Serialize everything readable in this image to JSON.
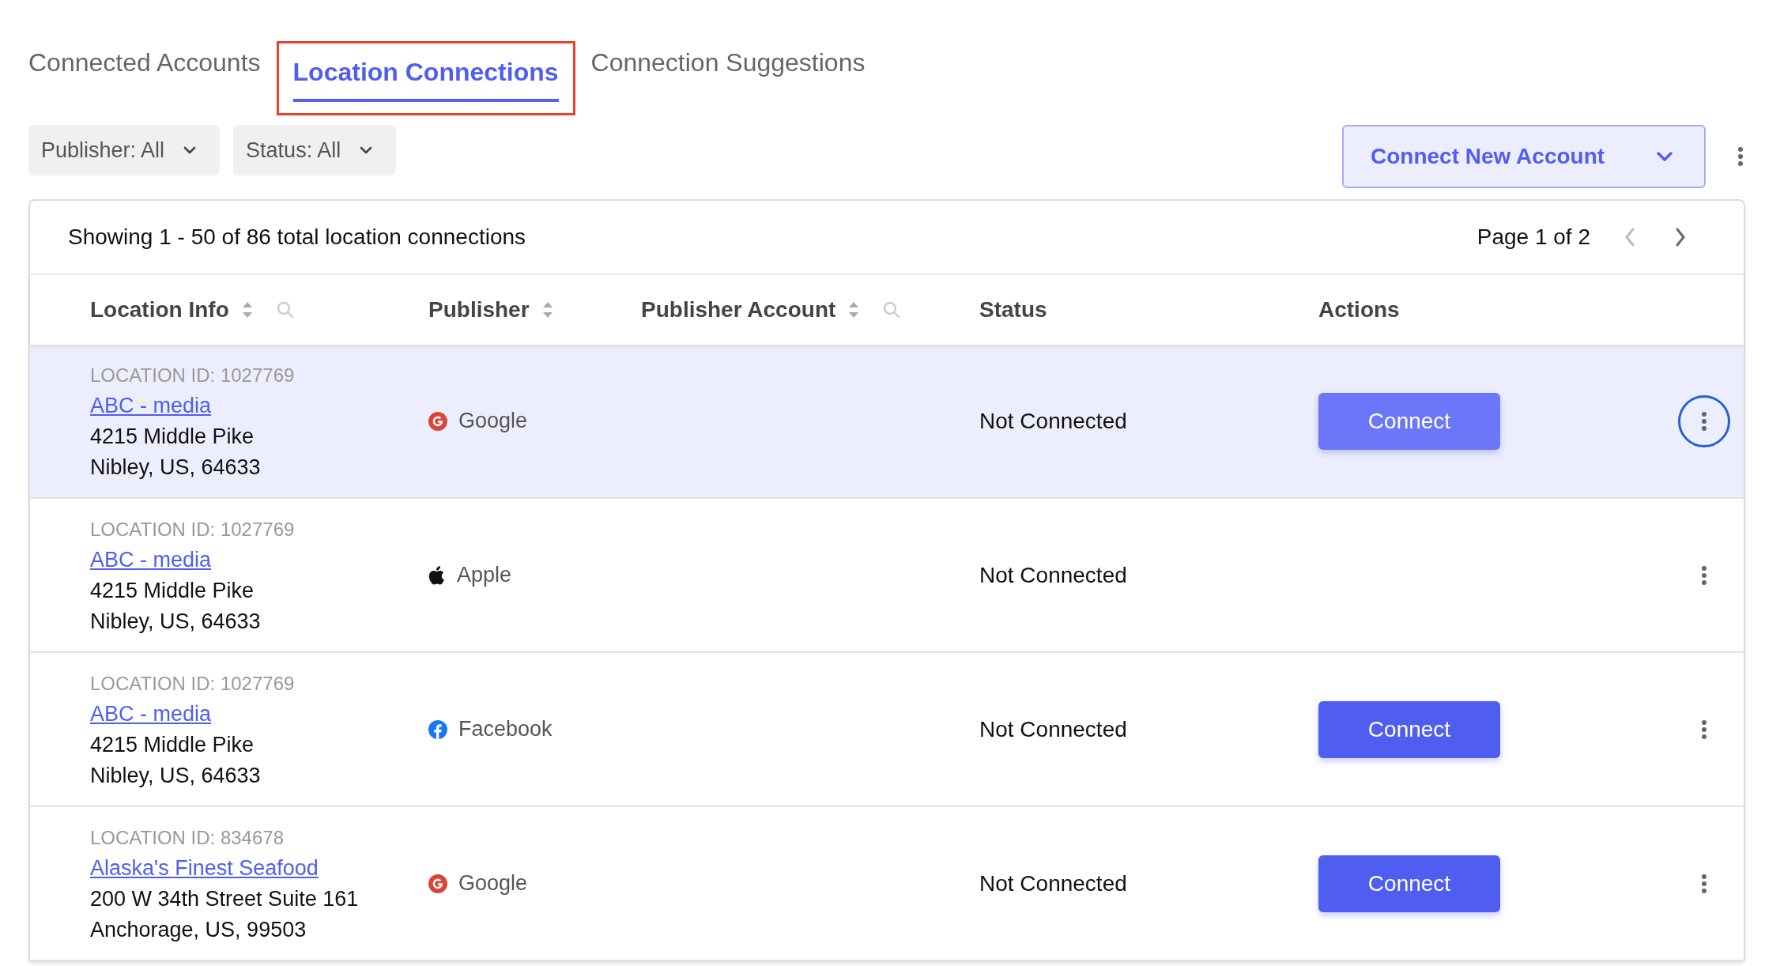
{
  "tabs": [
    {
      "label": "Connected Accounts",
      "selected": false
    },
    {
      "label": "Location Connections",
      "selected": true
    },
    {
      "label": "Connection Suggestions",
      "selected": false
    }
  ],
  "filters": [
    {
      "label": "Publisher: All"
    },
    {
      "label": "Status: All"
    }
  ],
  "connect_new_account": {
    "label": "Connect New Account"
  },
  "table": {
    "summary": "Showing 1 - 50 of 86 total location connections",
    "page": "Page 1 of 2",
    "columns": [
      {
        "label": "Location Info",
        "sortable": true,
        "searchable": true
      },
      {
        "label": "Publisher",
        "sortable": true,
        "searchable": false
      },
      {
        "label": "Publisher Account",
        "sortable": true,
        "searchable": true
      },
      {
        "label": "Status",
        "sortable": false,
        "searchable": false
      },
      {
        "label": "Actions",
        "sortable": false,
        "searchable": false
      }
    ],
    "rows": [
      {
        "selected": true,
        "location_id": "LOCATION ID: 1027769",
        "name": "ABC - media",
        "address": "4215 Middle Pike",
        "city": "Nibley, US, 64633",
        "publisher": {
          "kind": "google",
          "label": "Google"
        },
        "status": "Not Connected",
        "action": "Connect",
        "menu_focused": true
      },
      {
        "selected": false,
        "location_id": "LOCATION ID: 1027769",
        "name": "ABC - media",
        "address": "4215 Middle Pike",
        "city": "Nibley, US, 64633",
        "publisher": {
          "kind": "apple",
          "label": "Apple"
        },
        "status": "Not Connected",
        "menu_focused": false
      },
      {
        "selected": false,
        "location_id": "LOCATION ID: 1027769",
        "name": "ABC - media",
        "address": "4215 Middle Pike",
        "city": "Nibley, US, 64633",
        "publisher": {
          "kind": "facebook",
          "label": "Facebook"
        },
        "status": "Not Connected",
        "action": "Connect",
        "menu_focused": false
      },
      {
        "selected": false,
        "location_id": "LOCATION ID: 834678",
        "name": "Alaska's Finest Seafood",
        "address": "200 W 34th Street Suite 161",
        "city": "Anchorage, US, 99503",
        "publisher": {
          "kind": "google",
          "label": "Google"
        },
        "status": "Not Connected",
        "action": "Connect",
        "menu_focused": false
      }
    ]
  }
}
